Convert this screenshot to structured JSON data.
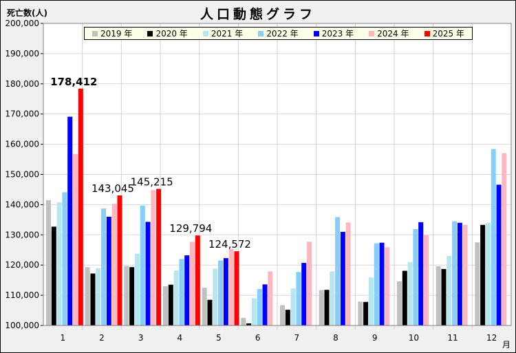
{
  "chart_data": {
    "type": "bar",
    "title": "人口動態グラフ",
    "ylabel": "死亡数(人)",
    "xlabel": "月",
    "ylim": [
      100000,
      200000
    ],
    "ytick_step": 10000,
    "grid": true,
    "legend_position": "top",
    "categories": [
      "1",
      "2",
      "3",
      "4",
      "5",
      "6",
      "7",
      "8",
      "9",
      "10",
      "11",
      "12"
    ],
    "series": [
      {
        "name": "2019 年",
        "color": "#c0c0c0",
        "values": [
          141500,
          119300,
          119700,
          113000,
          112500,
          102500,
          106700,
          111700,
          107900,
          114600,
          119600,
          127500
        ]
      },
      {
        "name": "2020 年",
        "color": "#000000",
        "values": [
          132700,
          117200,
          119300,
          113500,
          108500,
          100700,
          105200,
          111800,
          107800,
          118100,
          118700,
          133300
        ]
      },
      {
        "name": "2021 年",
        "color": "#b8e6f0",
        "values": [
          140800,
          119000,
          123800,
          118200,
          118800,
          109000,
          112300,
          117900,
          115900,
          121000,
          123000,
          134000
        ]
      },
      {
        "name": "2022 年",
        "color": "#87cefa",
        "values": [
          144100,
          138700,
          139700,
          122000,
          121500,
          112100,
          117700,
          135900,
          127200,
          131900,
          134500,
          158400
        ]
      },
      {
        "name": "2023 年",
        "color": "#0000ff",
        "values": [
          169100,
          136000,
          134300,
          123200,
          122300,
          113600,
          120700,
          131000,
          127400,
          134200,
          134000,
          146600
        ]
      },
      {
        "name": "2024 年",
        "color": "#ffb6c1",
        "values": [
          156800,
          140300,
          144800,
          127700,
          125400,
          117900,
          127700,
          134100,
          125900,
          129900,
          133300,
          157000
        ]
      },
      {
        "name": "2025 年",
        "color": "#ff0000",
        "values": [
          178412,
          143045,
          145215,
          129794,
          124572,
          null,
          null,
          null,
          null,
          null,
          null,
          null
        ]
      }
    ],
    "data_labels": [
      {
        "category": "1",
        "series": "2025 年",
        "text": "178,412",
        "bold": true
      },
      {
        "category": "2",
        "series": "2025 年",
        "text": "143,045",
        "bold": false
      },
      {
        "category": "3",
        "series": "2025 年",
        "text": "145,215",
        "bold": false
      },
      {
        "category": "4",
        "series": "2025 年",
        "text": "129,794",
        "bold": false
      },
      {
        "category": "5",
        "series": "2025 年",
        "text": "124,572",
        "bold": false
      }
    ]
  }
}
